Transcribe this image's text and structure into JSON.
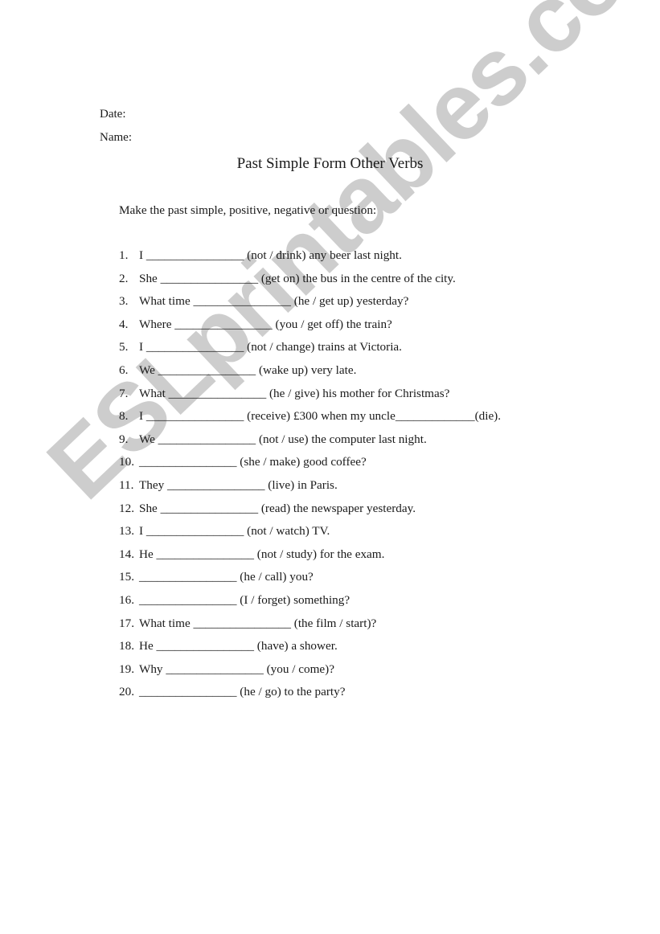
{
  "header": {
    "date_label": "Date:",
    "name_label": "Name:"
  },
  "title": "Past Simple Form Other Verbs",
  "instructions": "Make the past simple, positive, negative or question:",
  "exercises": [
    {
      "number": "1.",
      "text": "I ________________ (not / drink) any beer last night."
    },
    {
      "number": "2.",
      "text": "She ________________ (get on) the bus in the centre of the city."
    },
    {
      "number": "3.",
      "text": "What time ________________ (he / get up) yesterday?"
    },
    {
      "number": "4.",
      "text": "Where ________________ (you / get off) the train?"
    },
    {
      "number": "5.",
      "text": "I ________________ (not / change) trains at Victoria."
    },
    {
      "number": "6.",
      "text": "We ________________ (wake up) very late."
    },
    {
      "number": "7.",
      "text": "What ________________ (he / give) his mother for Christmas?"
    },
    {
      "number": "8.",
      "text": "I ________________ (receive) £300 when my uncle_____________(die)."
    },
    {
      "number": "9.",
      "text": "We ________________ (not / use) the computer last night."
    },
    {
      "number": "10.",
      "text": "________________ (she / make) good coffee?"
    },
    {
      "number": "11.",
      "text": "They ________________ (live) in Paris."
    },
    {
      "number": "12.",
      "text": "She ________________ (read) the newspaper yesterday."
    },
    {
      "number": "13.",
      "text": "I ________________ (not / watch) TV."
    },
    {
      "number": "14.",
      "text": "He ________________ (not / study) for the exam."
    },
    {
      "number": "15.",
      "text": "________________ (he / call) you?"
    },
    {
      "number": "16.",
      "text": "________________ (I / forget) something?"
    },
    {
      "number": "17.",
      "text": "What time ________________ (the film / start)?"
    },
    {
      "number": "18.",
      "text": "He ________________ (have) a shower."
    },
    {
      "number": "19.",
      "text": "Why ________________ (you / come)?"
    },
    {
      "number": "20.",
      "text": "________________ (he / go) to the party?"
    }
  ],
  "watermark": {
    "text": "ESLprintables.com",
    "color": "#c9c9c9"
  }
}
